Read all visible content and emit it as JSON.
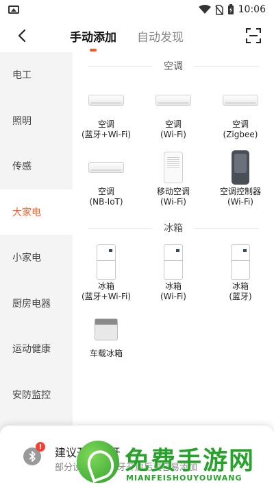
{
  "status_bar": {
    "time": "10:06"
  },
  "header": {
    "tabs": [
      {
        "label": "手动添加",
        "active": true
      },
      {
        "label": "自动发现",
        "active": false
      }
    ]
  },
  "sidebar": {
    "items": [
      {
        "label": "电工"
      },
      {
        "label": "照明"
      },
      {
        "label": "传感"
      },
      {
        "label": "大家电",
        "active": true
      },
      {
        "label": "小家电"
      },
      {
        "label": "厨房电器"
      },
      {
        "label": "运动健康"
      },
      {
        "label": "安防监控"
      }
    ]
  },
  "sections": [
    {
      "title": "空调",
      "devices": [
        {
          "name": "空调",
          "sub": "(蓝牙+Wi-Fi)",
          "icon": "air-conditioner"
        },
        {
          "name": "空调",
          "sub": "(Wi-Fi)",
          "icon": "air-conditioner"
        },
        {
          "name": "空调",
          "sub": "(Zigbee)",
          "icon": "air-conditioner"
        },
        {
          "name": "空调",
          "sub": "(NB-IoT)",
          "icon": "air-conditioner"
        },
        {
          "name": "移动空调",
          "sub": "(Wi-Fi)",
          "icon": "portable-air-conditioner"
        },
        {
          "name": "空调控制器",
          "sub": "(Wi-Fi)",
          "icon": "ac-controller"
        }
      ]
    },
    {
      "title": "冰箱",
      "devices": [
        {
          "name": "冰箱",
          "sub": "(蓝牙+Wi-Fi)",
          "icon": "refrigerator"
        },
        {
          "name": "冰箱",
          "sub": "(Wi-Fi)",
          "icon": "refrigerator"
        },
        {
          "name": "冰箱",
          "sub": "(蓝牙)",
          "icon": "refrigerator"
        },
        {
          "name": "车载冰箱",
          "sub": "",
          "icon": "car-refrigerator"
        }
      ]
    }
  ],
  "banner": {
    "title": "建议开启蓝牙",
    "subtitle": "部分设备需要蓝牙开启后更容易添加"
  },
  "watermark": {
    "title": "免费手游网",
    "subtitle": "MIANFEISHOUYOUWANG"
  }
}
